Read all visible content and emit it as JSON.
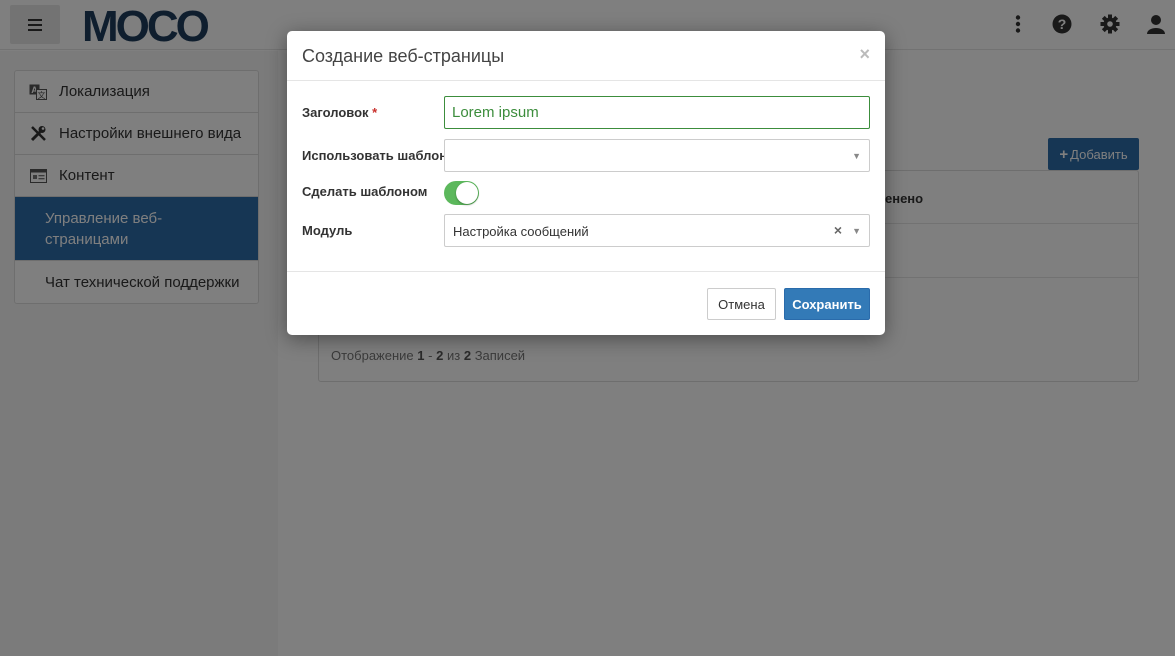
{
  "header": {
    "menu_icon": "hamburger-icon",
    "logo_text": "MOCO",
    "icons": [
      "kebab-menu-icon",
      "help-icon",
      "gear-icon",
      "user-icon"
    ]
  },
  "sidebar": {
    "items": [
      {
        "label": "Локализация",
        "icon": "translate-icon"
      },
      {
        "label": "Настройки внешнего вида",
        "icon": "tools-icon"
      },
      {
        "label": "Контент",
        "icon": "content-icon"
      },
      {
        "label": "Управление веб-\nстраницами"
      },
      {
        "label": "Чат технической поддержки"
      }
    ]
  },
  "main": {
    "add_button_label": "Добавить",
    "column_header": "енено",
    "footer": {
      "prefix": "Отображение",
      "from": "1",
      "dash": "-",
      "to": "2",
      "of": "из",
      "total": "2",
      "suffix": "Записей"
    }
  },
  "modal": {
    "title": "Создание веб-страницы",
    "close_glyph": "×",
    "fields": {
      "title_label": "Заголовок",
      "required_mark": "*",
      "title_value": "Lorem ipsum",
      "template_label": "Использовать шаблон",
      "template_value": "",
      "make_template_label": "Сделать шаблоном",
      "make_template_on": true,
      "module_label": "Модуль",
      "module_value": "Настройка сообщений"
    },
    "cancel_label": "Отмена",
    "save_label": "Сохранить"
  },
  "colors": {
    "accent": "#337ab7",
    "sidebar_active": "#2d6ca9",
    "toggle_on": "#5cb85c",
    "input_valid": "#3c8d3c"
  }
}
